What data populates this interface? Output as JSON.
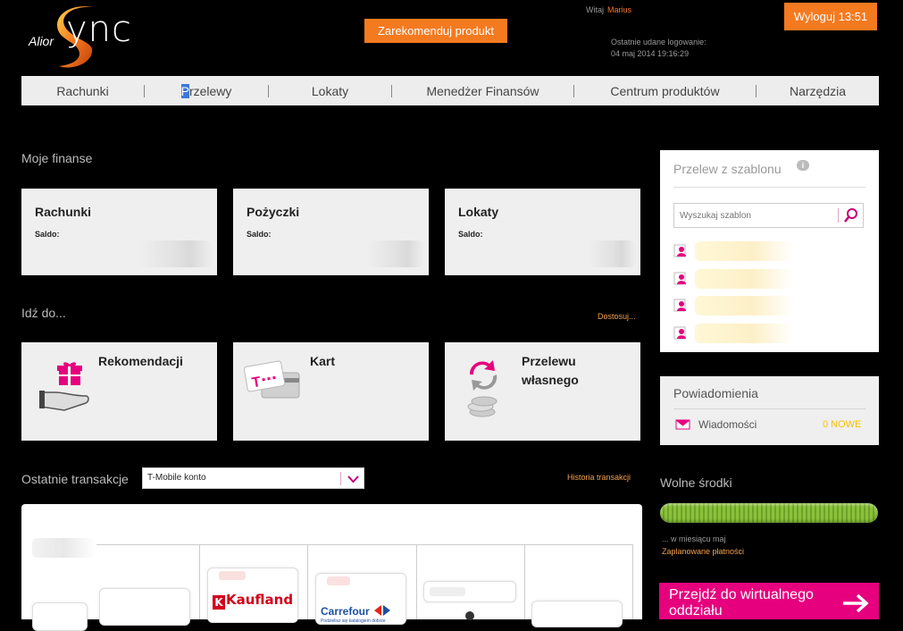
{
  "header": {
    "logo_prefix": "Alior",
    "logo_suffix": "ync",
    "recommend_label": "Zarekomenduj produkt",
    "welcome_label": "Witaj",
    "user_name": "Marius",
    "last_login_label": "Ostatnie udane logowanie:",
    "last_login_value": "04 maj 2014 19:16:29",
    "logout_label": "Wyloguj 13:51"
  },
  "nav": {
    "items": [
      {
        "label": "Rachunki"
      },
      {
        "label_first": "P",
        "label_rest": "rzelewy"
      },
      {
        "label": "Lokaty"
      },
      {
        "label": "Menedżer Finansów"
      },
      {
        "label": "Centrum produktów"
      },
      {
        "label": "Narzędzia"
      }
    ]
  },
  "finances": {
    "title": "Moje finanse",
    "cards": [
      {
        "title": "Rachunki",
        "saldo_label": "Saldo:"
      },
      {
        "title": "Pożyczki",
        "saldo_label": "Saldo:"
      },
      {
        "title": "Lokaty",
        "saldo_label": "Saldo:"
      }
    ]
  },
  "goto": {
    "title": "Idź do...",
    "customize_label": "Dostosuj...",
    "cards": [
      {
        "line1": "Rekomendacji",
        "line2": "",
        "icon": "gift-hand-icon"
      },
      {
        "line1": "Kart",
        "line2": "",
        "icon": "cards-icon"
      },
      {
        "line1": "Przelewu",
        "line2": "własnego",
        "icon": "transfer-coins-icon"
      }
    ]
  },
  "transactions": {
    "title": "Ostatnie transakcje",
    "account_selected": "T-Mobile konto",
    "history_label": "Historia transakcji",
    "merchants": [
      "Kaufland",
      "Carrefour"
    ],
    "carrefour_sub": "Podzielisz się katalogiem dobrze"
  },
  "templates": {
    "title": "Przelew z szablonu",
    "info_glyph": "i",
    "search_placeholder": "Wyszukaj szablon"
  },
  "notifications": {
    "title": "Powiadomienia",
    "messages_label": "Wiadomości",
    "new_count": "0 NOWE"
  },
  "free_funds": {
    "title": "Wolne środki",
    "sub_label": "... w miesiącu maj",
    "planned_label": "Zaplanowane płatności"
  },
  "virtual_branch": {
    "label": "Przejdź do wirtualnego oddziału"
  },
  "colors": {
    "accent_orange": "#f47a20",
    "magenta": "#e6007e",
    "bar_green": "#8ac23a"
  }
}
